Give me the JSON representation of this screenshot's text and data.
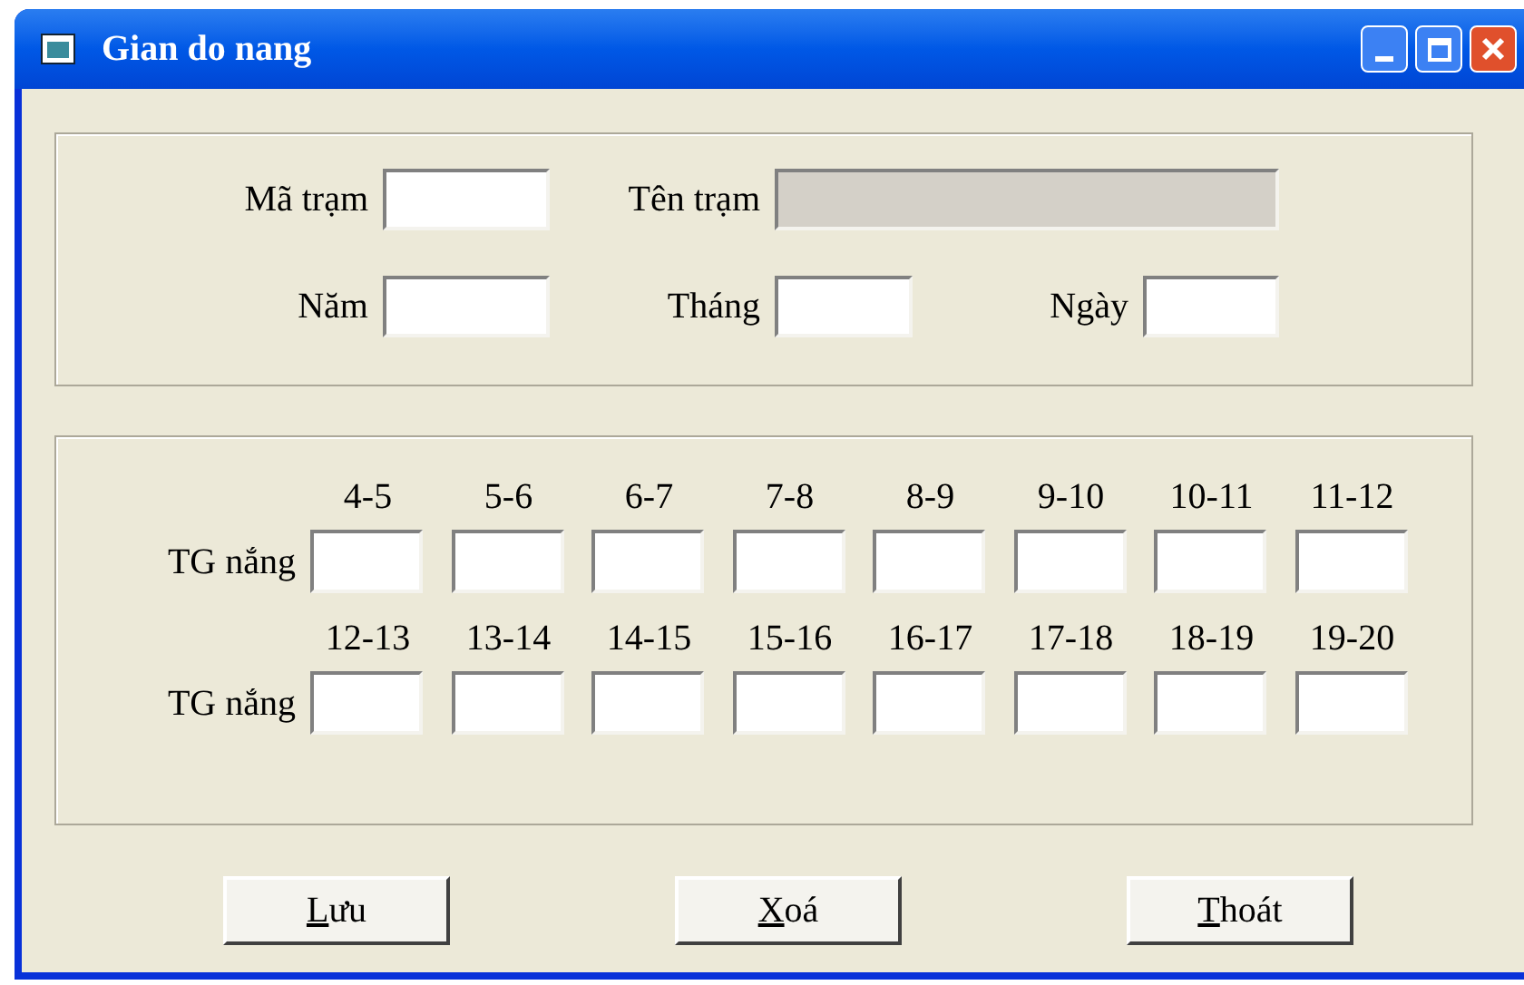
{
  "window": {
    "title": "Gian do nang"
  },
  "station": [
    {
      "label": "Mã trạm",
      "disabled": false
    },
    {
      "label": "Tên trạm",
      "disabled": true
    }
  ],
  "date": [
    {
      "label": "Năm",
      "disabled": false
    },
    {
      "label": "Tháng",
      "disabled": false
    },
    {
      "label": "Ngày",
      "disabled": false
    }
  ],
  "hours": [
    {
      "row_label": "TG nắng",
      "slots": [
        "4-5",
        "5-6",
        "6-7",
        "7-8",
        "8-9",
        "9-10",
        "10-11",
        "11-12"
      ]
    },
    {
      "row_label": "TG nắng",
      "slots": [
        "12-13",
        "13-14",
        "14-15",
        "15-16",
        "16-17",
        "17-18",
        "18-19",
        "19-20"
      ]
    }
  ],
  "buttons": [
    {
      "accelerator": "L",
      "rest": "ưu"
    },
    {
      "accelerator": "X",
      "rest": "oá"
    },
    {
      "accelerator": "T",
      "rest": "hoát"
    }
  ]
}
